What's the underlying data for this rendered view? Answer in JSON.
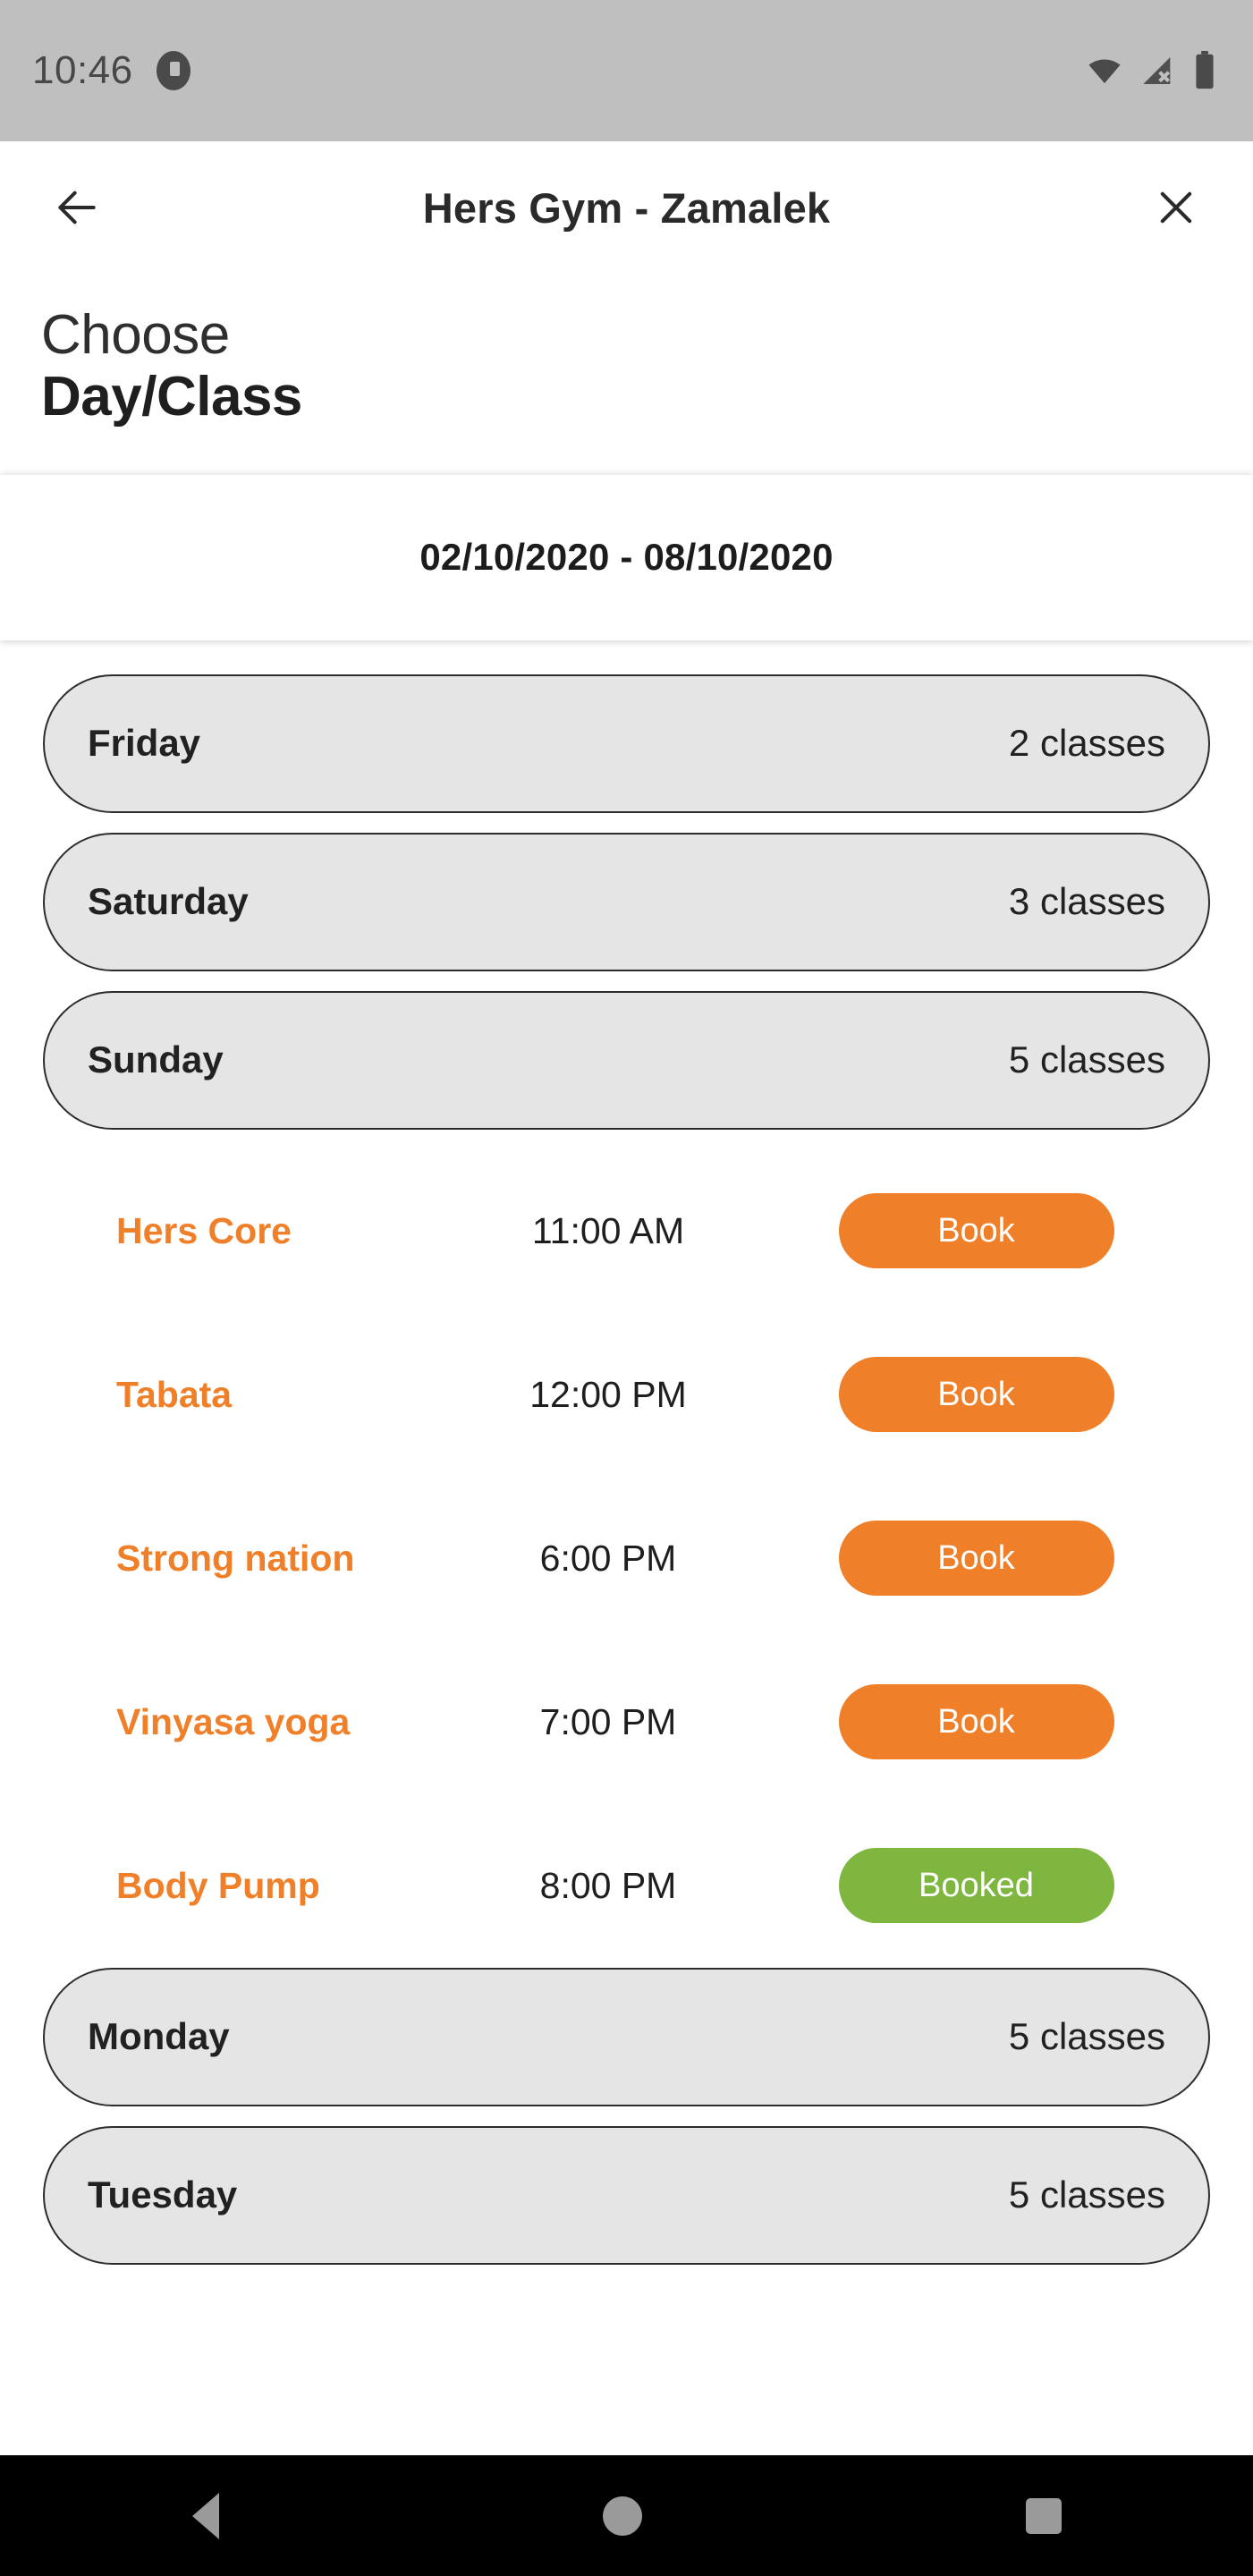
{
  "status_bar": {
    "time": "10:46",
    "icons": [
      "notification-icon",
      "wifi-icon",
      "cellular-no-signal-icon",
      "battery-full-icon"
    ]
  },
  "app_bar": {
    "back_icon": "back-arrow-icon",
    "title": "Hers Gym - Zamalek",
    "close_icon": "close-icon"
  },
  "heading": {
    "line1": "Choose",
    "line2": "Day/Class"
  },
  "date_range": {
    "label": "02/10/2020 - 08/10/2020"
  },
  "colors": {
    "accent_orange": "#ef7f28",
    "booked_green": "#7eb63f",
    "pill_gray": "#e5e5e5",
    "status_bar_gray": "#bfbfbf"
  },
  "schedule": [
    {
      "type": "day",
      "day": "Friday",
      "count_label": "2 classes",
      "expanded": false,
      "classes": []
    },
    {
      "type": "day",
      "day": "Saturday",
      "count_label": "3 classes",
      "expanded": false,
      "classes": []
    },
    {
      "type": "day",
      "day": "Sunday",
      "count_label": "5 classes",
      "expanded": true,
      "classes": [
        {
          "name": "Hers Core",
          "time": "11:00 AM",
          "action": "Book",
          "state": "book"
        },
        {
          "name": "Tabata",
          "time": "12:00 PM",
          "action": "Book",
          "state": "book"
        },
        {
          "name": "Strong nation",
          "time": "6:00 PM",
          "action": "Book",
          "state": "book"
        },
        {
          "name": "Vinyasa yoga",
          "time": "7:00 PM",
          "action": "Book",
          "state": "book"
        },
        {
          "name": "Body Pump",
          "time": "8:00 PM",
          "action": "Booked",
          "state": "booked"
        }
      ]
    },
    {
      "type": "day",
      "day": "Monday",
      "count_label": "5 classes",
      "expanded": false,
      "classes": []
    },
    {
      "type": "day",
      "day": "Tuesday",
      "count_label": "5 classes",
      "expanded": false,
      "classes": []
    }
  ],
  "nav_bar": {
    "back": "nav-back-icon",
    "home": "nav-home-icon",
    "recents": "nav-recents-icon"
  }
}
